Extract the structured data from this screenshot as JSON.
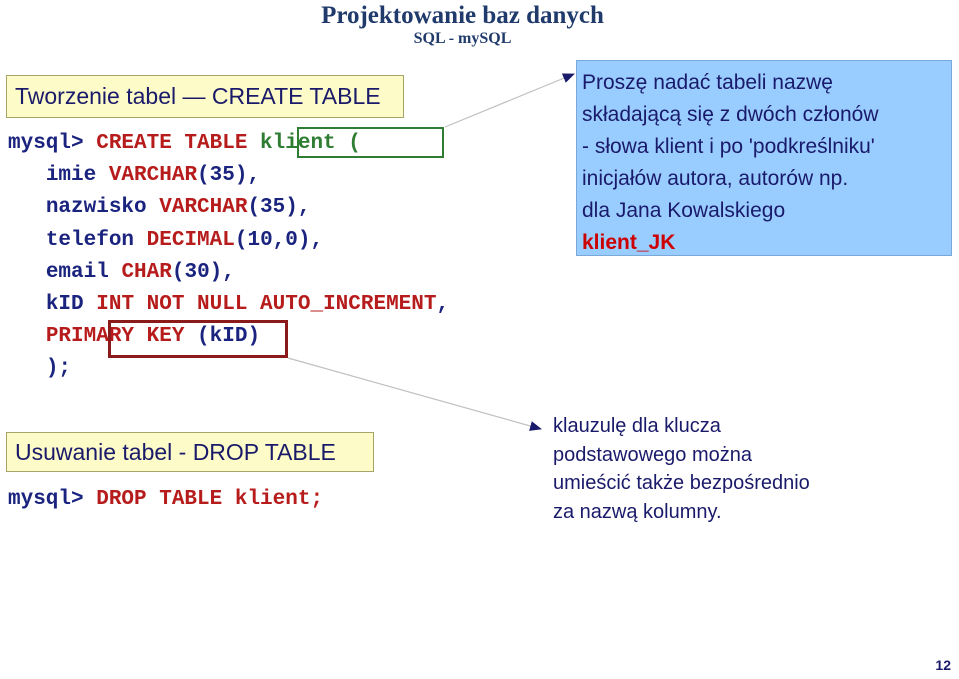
{
  "header": {
    "title": "Projektowanie baz danych",
    "subtitle": "SQL - mySQL"
  },
  "sections": {
    "create": {
      "label": "Tworzenie tabel — CREATE TABLE"
    },
    "drop": {
      "label": "Usuwanie tabel - DROP TABLE"
    }
  },
  "create_sql": {
    "line1": {
      "prompt": "mysql> ",
      "kw": "CREATE TABLE ",
      "name": "klient ("
    },
    "line2": {
      "indent": "   ",
      "col": "imie ",
      "type": "VARCHAR",
      "args": "(35),"
    },
    "line3": {
      "indent": "   ",
      "col": "nazwisko ",
      "type": "VARCHAR",
      "args": "(35),"
    },
    "line4": {
      "indent": "   ",
      "col": "telefon ",
      "type": "DECIMAL",
      "args": "(10,0),"
    },
    "line5": {
      "indent": "   ",
      "col": "email ",
      "type": "CHAR",
      "args": "(30),"
    },
    "line6": {
      "indent": "   ",
      "col": "kID ",
      "type": "INT NOT NULL AUTO_INCREMENT",
      "args": ","
    },
    "line7": {
      "indent": "   ",
      "kw": "PRIMARY KEY",
      "args": " (kID)"
    },
    "line8": {
      "indent": "   ",
      "end": ");"
    }
  },
  "drop_sql": {
    "prompt": "mysql> ",
    "kw": "DROP TABLE ",
    "name": "klient;"
  },
  "note_name": {
    "lines": [
      "Proszę nadać tabeli nazwę",
      "składającą się z dwóch członów",
      "- słowa klient i po 'podkreślniku'",
      "inicjałów autora, autorów np.",
      "dla Jana Kowalskiego"
    ],
    "example": "klient_JK"
  },
  "note_key": {
    "lines": [
      "klauzulę dla klucza",
      "podstawowego można",
      "umieścić także bezpośrednio",
      "za nazwą kolumny."
    ]
  },
  "page_number": "12",
  "colors": {
    "section_bg": "#fdfcc8",
    "note_bg": "#99ccff",
    "keyword": "#b71c1c",
    "identifier": "#2e7d32",
    "text": "#1a237e"
  }
}
